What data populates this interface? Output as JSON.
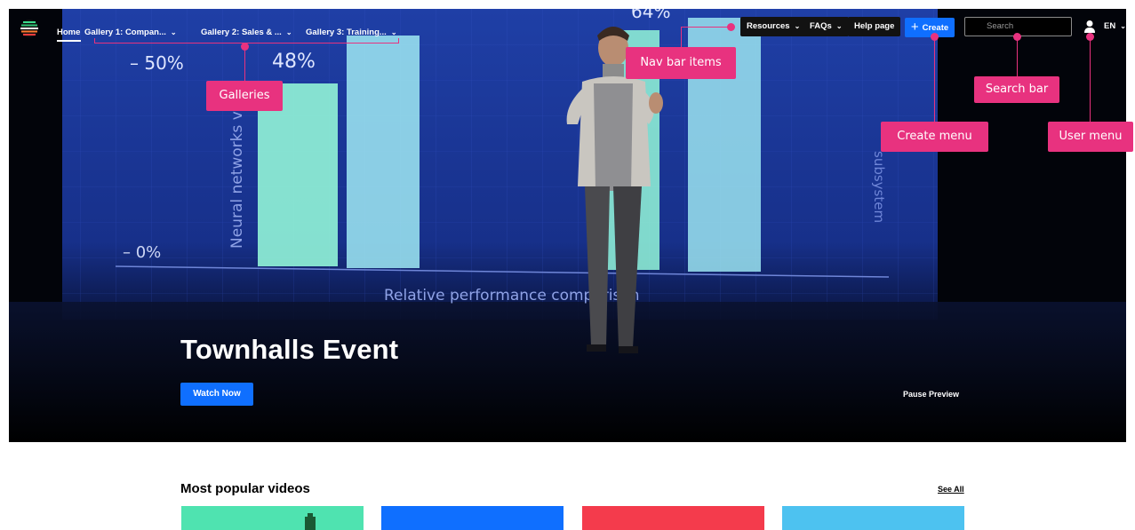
{
  "nav": {
    "home": "Home",
    "galleries": [
      {
        "label": "Gallery 1: Compan...",
        "chevron": "chevron-down-icon"
      },
      {
        "label": "Gallery 2: Sales & ...",
        "chevron": "chevron-down-icon"
      },
      {
        "label": "Gallery 3: Training...",
        "chevron": "chevron-down-icon"
      }
    ],
    "resources": "Resources",
    "faqs": "FAQs",
    "help": "Help page",
    "create": "Create",
    "search_placeholder": "Search",
    "lang": "EN",
    "icons": {
      "logo": "striped-circle-logo",
      "user": "user-icon",
      "create": "plus-icon"
    }
  },
  "annotations": {
    "galleries": "Galleries",
    "nav_bar_items": "Nav bar items",
    "search_bar": "Search bar",
    "create_menu": "Create menu",
    "user_menu": "User menu"
  },
  "hero": {
    "title": "Townhalls Event",
    "watch_now": "Watch Now",
    "pause_preview": "Pause Preview",
    "screen_text": {
      "pct_50": "– 50%",
      "pct_48": "48%",
      "pct_64": "64%",
      "pct_0": "– 0%",
      "ylabel": "Neural networks v...",
      "xlabel": "Relative performance comparison",
      "right_label": "subsystem"
    }
  },
  "section": {
    "title": "Most popular videos",
    "see_all": "See All",
    "thumbnail_colors": [
      "#4fe3b0",
      "#0f6fff",
      "#f43b4c",
      "#4dc2f0"
    ]
  },
  "colors": {
    "accent": "#0f6fff",
    "annotation": "#e8327f",
    "screen_blue": "#1d3a9a",
    "bar_mint": "#8ff0d6"
  }
}
